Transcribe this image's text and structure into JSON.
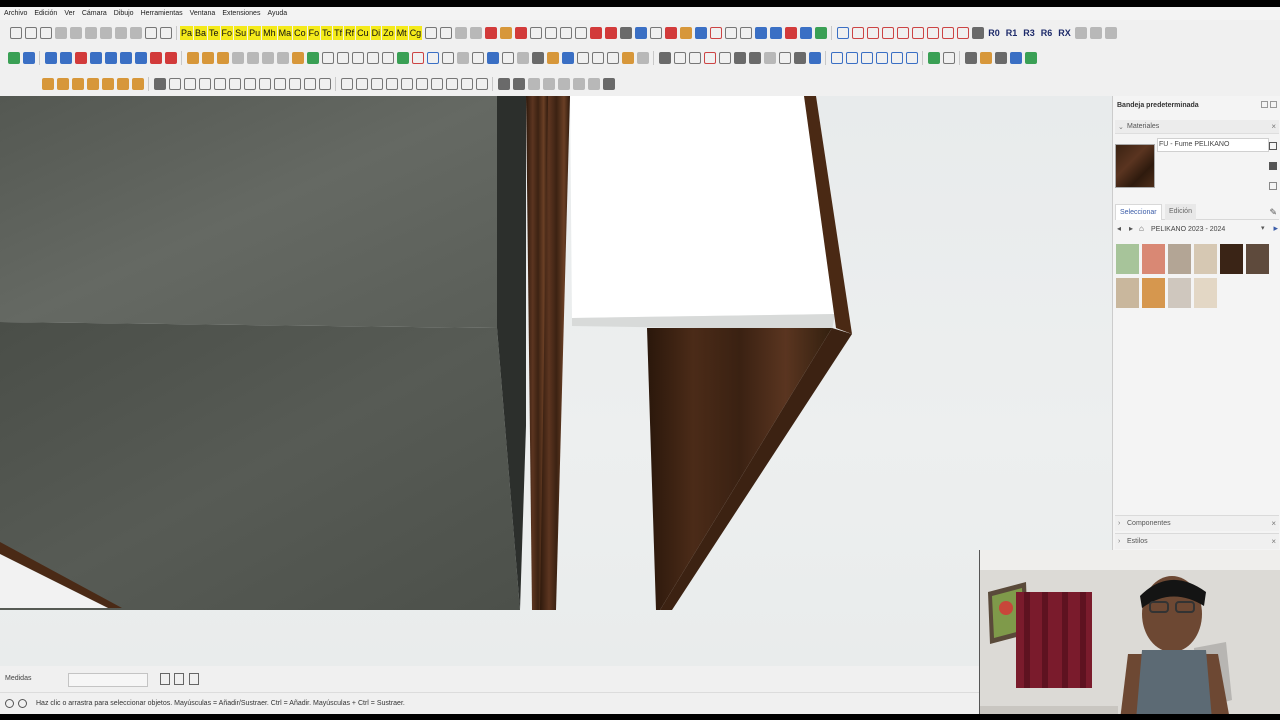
{
  "menu": [
    "Archivo",
    "Edición",
    "Ver",
    "Cámara",
    "Dibujo",
    "Herramientas",
    "Ventana",
    "Extensiones",
    "Ayuda"
  ],
  "toolbar1": {
    "yellow_labels": [
      "Pa",
      "Ba",
      "Te",
      "Fo",
      "Su",
      "Pu",
      "Mh",
      "Ma",
      "Co",
      "Fo",
      "Tc",
      "Tf",
      "Rf",
      "Cu",
      "Di",
      "Zo",
      "Mt",
      "Cg"
    ],
    "right_labels": [
      "R0",
      "R1",
      "R3",
      "R6",
      "RX"
    ]
  },
  "viewport": {
    "colors": {
      "concrete": "#5b5f59",
      "wood_dark": "#3b2314",
      "white_panel": "#ffffff"
    }
  },
  "measurements": {
    "label": "Medidas",
    "value": ""
  },
  "status": {
    "text": "Haz clic o arrastra para seleccionar objetos. Mayúsculas = Añadir/Sustraer. Ctrl = Añadir. Mayúsculas + Ctrl = Sustraer."
  },
  "tray": {
    "title": "Bandeja predeterminada",
    "materials_section": "Materiales",
    "material_name": "FU - Fume PELIKANO",
    "tabs": [
      "Seleccionar",
      "Edición"
    ],
    "library": "PELIKANO 2023 - 2024",
    "swatches": [
      "#a7c49a",
      "#d98874",
      "#b3a595",
      "#d6c8b3",
      "#3a2416",
      "#5e4a3c",
      "#c9b79d",
      "#d6974e",
      "#cfc7be",
      "#e3d7c5"
    ],
    "collapsed_sections": [
      "Componentes",
      "Estilos"
    ]
  }
}
